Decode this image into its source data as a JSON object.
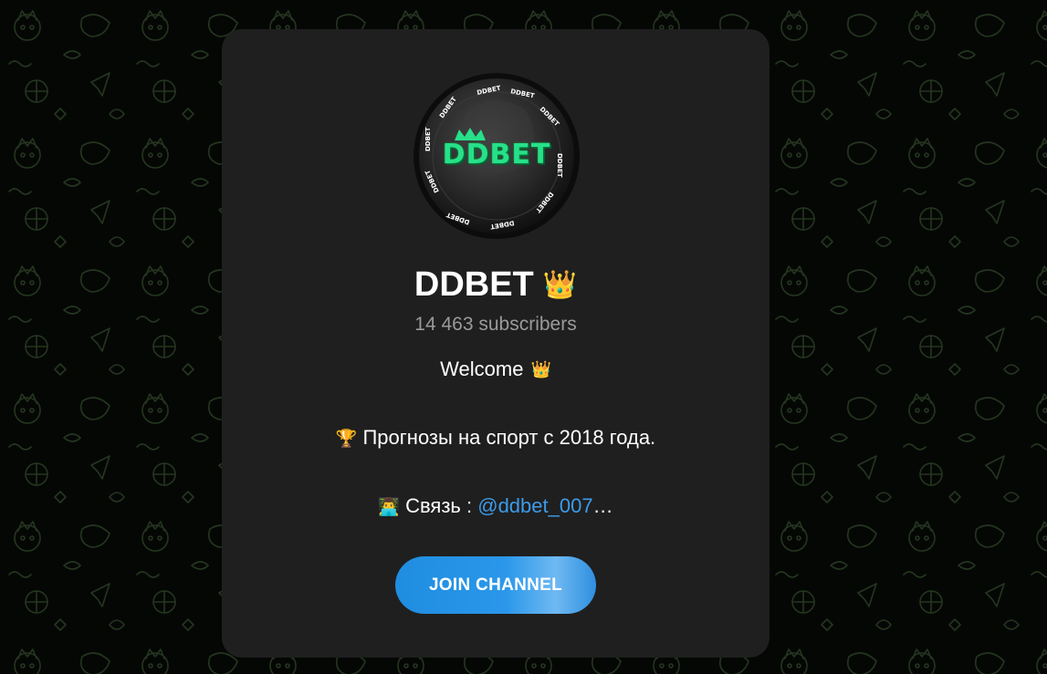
{
  "channel": {
    "avatar_logo_text": "DDBET",
    "avatar_ring_text": "DDBET",
    "title": "DDBET",
    "title_emoji": "👑",
    "subscribers": "14 463 subscribers"
  },
  "description": {
    "welcome_text": "Welcome",
    "welcome_emoji": "👑",
    "forecast_emoji": "🏆",
    "forecast_text": "Прогнозы на спорт с 2018 года.",
    "contact_emoji": "👨‍💻",
    "contact_label": "Связь : ",
    "contact_link": "@ddbet_007",
    "contact_ellipsis": "…"
  },
  "actions": {
    "join_label": "JOIN CHANNEL"
  },
  "colors": {
    "card_background": "#1f1f1f",
    "accent_link": "#3d9be9",
    "button": "#2a97ea",
    "logo_green": "#27e08a",
    "muted_text": "#9a9a9a"
  },
  "icons": {
    "background_pattern": "doodle-pattern-icon",
    "crown": "crown-icon",
    "trophy": "trophy-icon",
    "technologist": "technologist-icon"
  }
}
